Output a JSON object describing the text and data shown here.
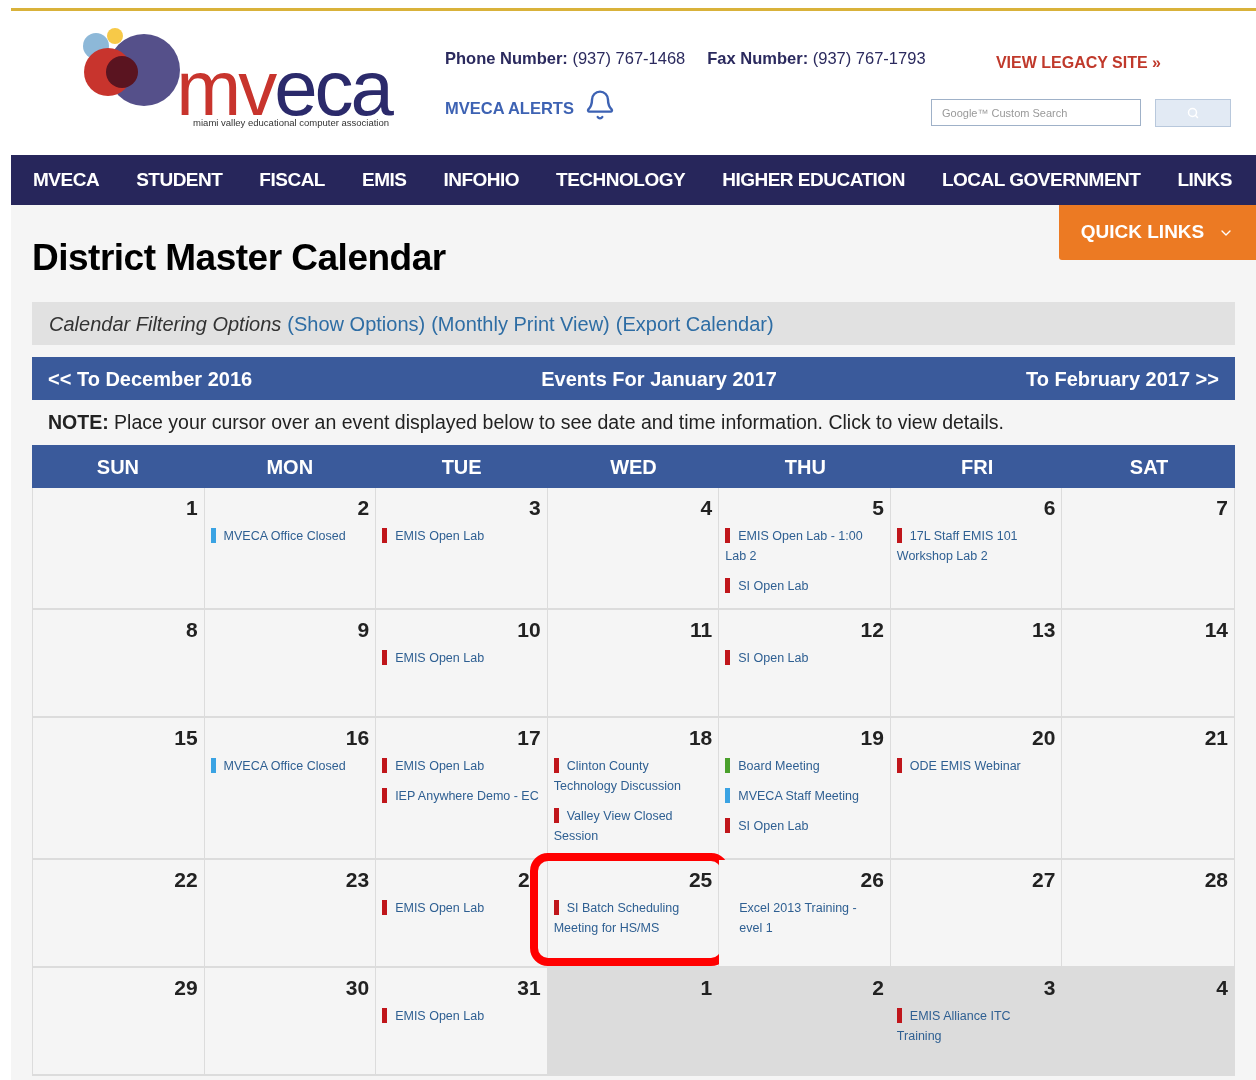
{
  "header": {
    "logo": {
      "name_red": "mv",
      "name_navy": "eca",
      "tagline": "miami valley educational computer association"
    },
    "phone": {
      "label": "Phone Number:",
      "value": "(937) 767-1468"
    },
    "fax": {
      "label": "Fax Number:",
      "value": "(937) 767-1793"
    },
    "legacy_link": "VIEW LEGACY SITE »",
    "alerts_link": "MVECA ALERTS",
    "search": {
      "placeholder": "Google™ Custom Search"
    }
  },
  "nav": [
    "MVECA",
    "STUDENT",
    "FISCAL",
    "EMIS",
    "INFOHIO",
    "TECHNOLOGY",
    "HIGHER EDUCATION",
    "LOCAL GOVERNMENT",
    "LINKS"
  ],
  "quick_links": "QUICK LINKS",
  "page_title": "District Master Calendar",
  "filter_bar": {
    "label": "Calendar Filtering Options",
    "links": [
      "(Show Options)",
      "(Monthly Print View)",
      "(Export Calendar)"
    ]
  },
  "month_bar": {
    "prev": "<< To December 2016",
    "title": "Events For January 2017",
    "next": "To February 2017 >>"
  },
  "note": "**NOTE:** Place your cursor over an event displayed below to see date and time information. Click to view details.",
  "weekdays": [
    "SUN",
    "MON",
    "TUE",
    "WED",
    "THU",
    "FRI",
    "SAT"
  ],
  "weeks": [
    {
      "days": [
        {
          "day": "1",
          "other_month": false
        },
        {
          "day": "2",
          "other_month": false,
          "events": [
            {
              "title": "MVECA Office Closed",
              "color": "#3aa3e3"
            }
          ]
        },
        {
          "day": "3",
          "other_month": false,
          "events": [
            {
              "title": "EMIS Open Lab",
              "color": "#c0161b"
            }
          ]
        },
        {
          "day": "4",
          "other_month": false
        },
        {
          "day": "5",
          "other_month": false,
          "events": [
            {
              "title": "EMIS Open Lab - 1:00 Lab 2",
              "color": "#c0161b"
            },
            {
              "title": "SI Open Lab",
              "color": "#c0161b"
            }
          ]
        },
        {
          "day": "6",
          "other_month": false,
          "events": [
            {
              "title": "17L Staff EMIS 101 Workshop Lab 2",
              "color": "#c0161b"
            }
          ]
        },
        {
          "day": "7",
          "other_month": false
        }
      ]
    },
    {
      "days": [
        {
          "day": "8",
          "other_month": false
        },
        {
          "day": "9",
          "other_month": false
        },
        {
          "day": "10",
          "other_month": false,
          "events": [
            {
              "title": "EMIS Open Lab",
              "color": "#c0161b"
            }
          ]
        },
        {
          "day": "11",
          "other_month": false
        },
        {
          "day": "12",
          "other_month": false,
          "events": [
            {
              "title": "SI Open Lab",
              "color": "#c0161b"
            }
          ]
        },
        {
          "day": "13",
          "other_month": false
        },
        {
          "day": "14",
          "other_month": false
        }
      ]
    },
    {
      "days": [
        {
          "day": "15",
          "other_month": false
        },
        {
          "day": "16",
          "other_month": false,
          "events": [
            {
              "title": "MVECA Office Closed",
              "color": "#3aa3e3"
            }
          ]
        },
        {
          "day": "17",
          "other_month": false,
          "events": [
            {
              "title": "EMIS Open Lab",
              "color": "#c0161b"
            },
            {
              "title": "IEP Anywhere Demo - EC",
              "color": "#c0161b"
            }
          ]
        },
        {
          "day": "18",
          "other_month": false,
          "events": [
            {
              "title": "Clinton County Technology Discussion",
              "color": "#c0161b"
            },
            {
              "title": "Valley View Closed Session",
              "color": "#c0161b"
            }
          ]
        },
        {
          "day": "19",
          "other_month": false,
          "events": [
            {
              "title": "Board Meeting",
              "color": "#4aa02c"
            },
            {
              "title": "MVECA Staff Meeting",
              "color": "#3aa3e3"
            },
            {
              "title": "SI Open Lab",
              "color": "#c0161b"
            }
          ]
        },
        {
          "day": "20",
          "other_month": false,
          "events": [
            {
              "title": "ODE EMIS Webinar",
              "color": "#c0161b"
            }
          ]
        },
        {
          "day": "21",
          "other_month": false
        }
      ]
    },
    {
      "days": [
        {
          "day": "22",
          "other_month": false
        },
        {
          "day": "23",
          "other_month": false
        },
        {
          "day": "2",
          "other_month": false,
          "events": [
            {
              "title": "EMIS Open Lab",
              "color": "#c0161b"
            }
          ]
        },
        {
          "day": "25",
          "other_month": false,
          "highlighted": true,
          "events": [
            {
              "title": "SI Batch Scheduling Meeting for HS/MS",
              "color": "#c0161b"
            }
          ]
        },
        {
          "day": "26",
          "other_month": false,
          "events": [
            {
              "title": "Excel 2013 Training - evel 1"
            }
          ]
        },
        {
          "day": "27",
          "other_month": false
        },
        {
          "day": "28",
          "other_month": false
        }
      ]
    },
    {
      "days": [
        {
          "day": "29",
          "other_month": false
        },
        {
          "day": "30",
          "other_month": false
        },
        {
          "day": "31",
          "other_month": false,
          "events": [
            {
              "title": "EMIS Open Lab",
              "color": "#c0161b"
            }
          ]
        },
        {
          "day": "1",
          "other_month": true
        },
        {
          "day": "2",
          "other_month": true
        },
        {
          "day": "3",
          "other_month": true,
          "events": [
            {
              "title": "EMIS Alliance ITC Training",
              "color": "#c0161b"
            }
          ]
        },
        {
          "day": "4",
          "other_month": true
        }
      ]
    }
  ]
}
